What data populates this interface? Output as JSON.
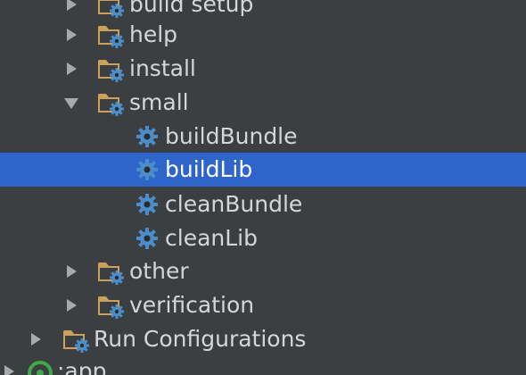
{
  "tree": {
    "items": [
      {
        "label": "build setup",
        "icon": "gradle-folder-icon",
        "expanded": false
      },
      {
        "label": "help",
        "icon": "gradle-folder-icon",
        "expanded": false
      },
      {
        "label": "install",
        "icon": "gradle-folder-icon",
        "expanded": false
      },
      {
        "label": "small",
        "icon": "gradle-folder-icon",
        "expanded": true
      },
      {
        "label": "buildBundle",
        "icon": "gradle-task-gear-icon"
      },
      {
        "label": "buildLib",
        "icon": "gradle-task-gear-icon",
        "selected": true
      },
      {
        "label": "cleanBundle",
        "icon": "gradle-task-gear-icon"
      },
      {
        "label": "cleanLib",
        "icon": "gradle-task-gear-icon"
      },
      {
        "label": "other",
        "icon": "gradle-folder-icon",
        "expanded": false
      },
      {
        "label": "verification",
        "icon": "gradle-folder-icon",
        "expanded": false
      },
      {
        "label": "Run Configurations",
        "icon": "gradle-folder-icon",
        "expanded": false
      },
      {
        "label": ":app",
        "icon": "android-module-icon",
        "expanded": false
      }
    ]
  },
  "colors": {
    "background": "#3c3f41",
    "selection": "#2f65ca",
    "text": "#d6d6d6",
    "selected_text": "#ffffff",
    "folder": "#c9a15a",
    "gear": "#4a8dc9",
    "arrow": "#a9a9a9"
  }
}
